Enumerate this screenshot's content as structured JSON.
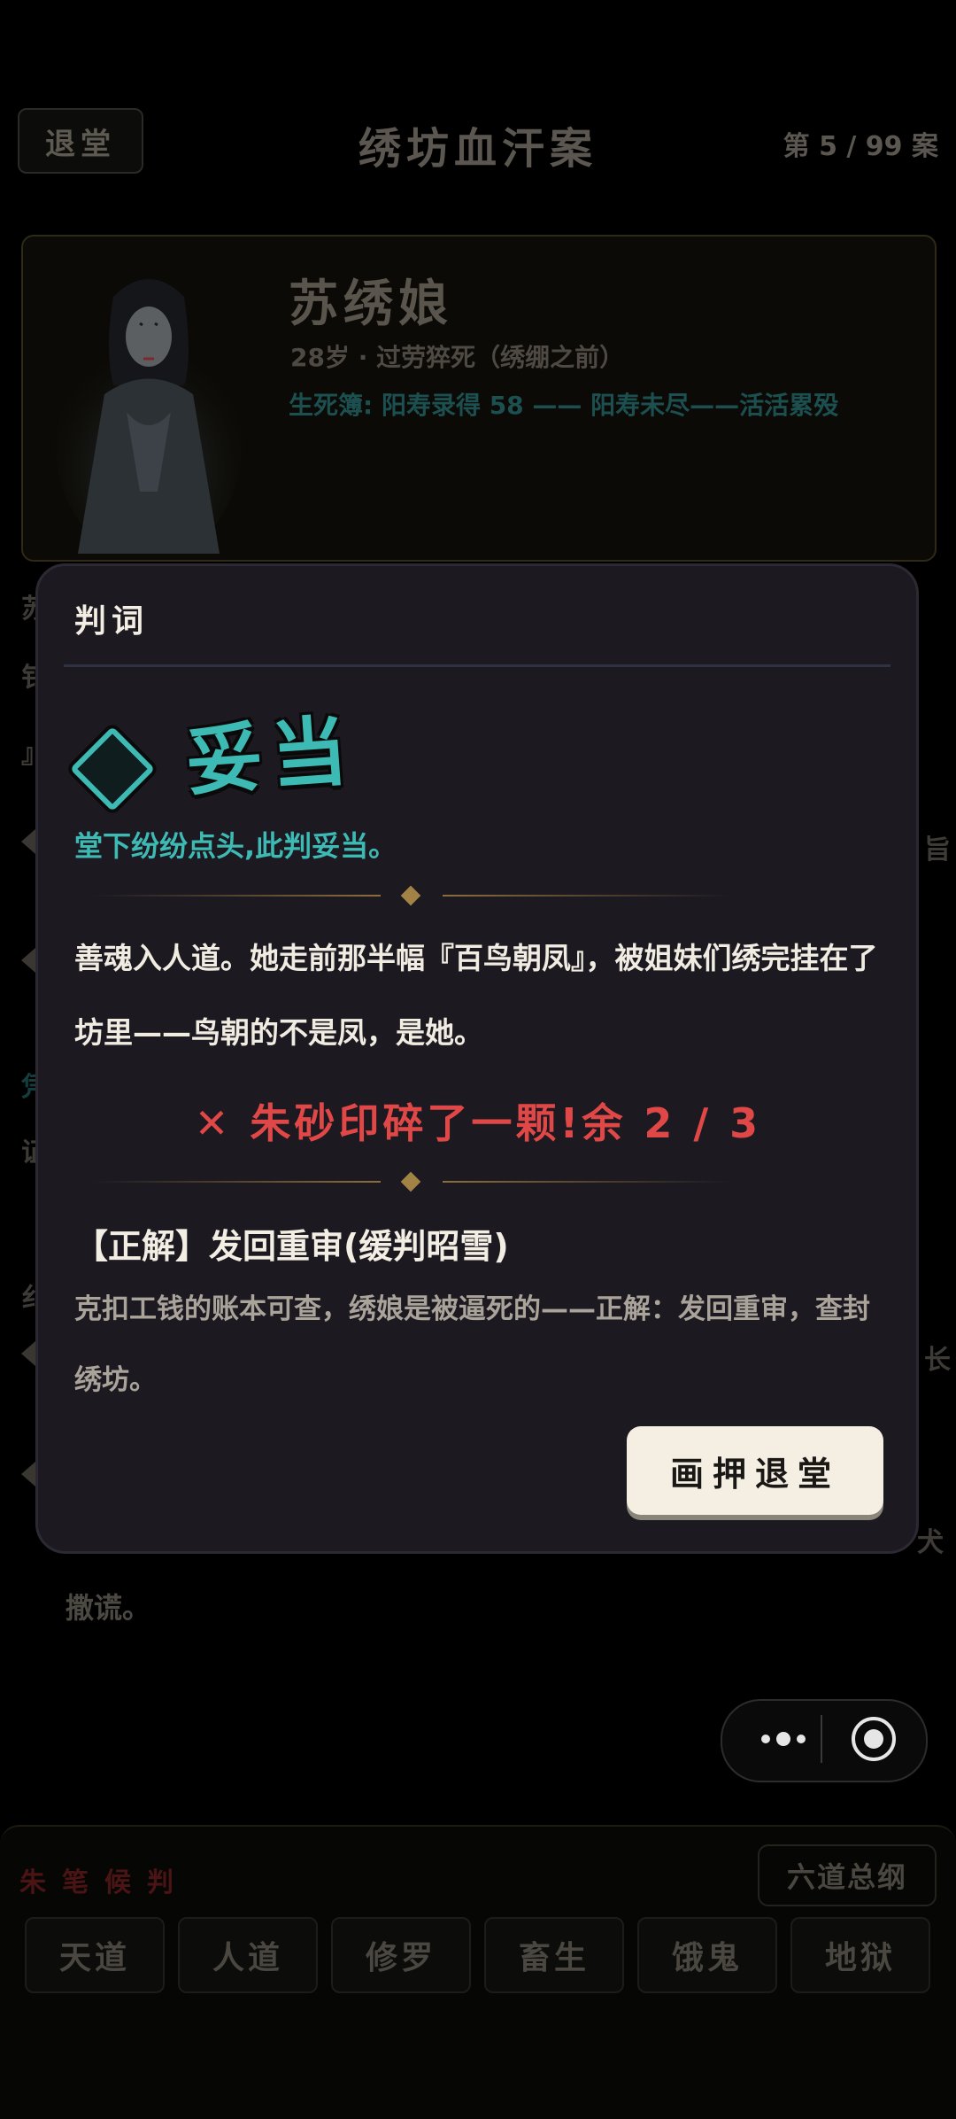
{
  "header": {
    "back_label": "退堂",
    "title": "绣坊血汗案",
    "progress": "第 5 / 99 案"
  },
  "profile": {
    "name": "苏绣娘",
    "meta": "28岁 · 过劳猝死（绣绷之前）",
    "lifebook": "生死簿: 阳寿录得 58 —— 阳寿未尽——活活累殁"
  },
  "background_partial": {
    "left_fragments": [
      "苏",
      "钅",
      "』",
      "凭",
      "证",
      "纟"
    ],
    "right_fragments": [
      "旨",
      "长",
      "犬"
    ],
    "lie_text": "撒谎。"
  },
  "modal": {
    "title": "判词",
    "verdict": "妥当",
    "verdict_sub": "堂下纷纷点头,此判妥当。",
    "story": "善魂入人道。她走前那半幅『百鸟朝凤』，被姐妹们绣完挂在了坊里——鸟朝的不是凤，是她。",
    "penalty": "✕ 朱砂印碎了一颗!余 2 / 3",
    "answer_head": "【正解】发回重审(缓判昭雪)",
    "answer_body": "克扣工钱的账本可查，绣娘是被逼死的——正解：发回重审，查封绣坊。",
    "sign_button": "画押退堂"
  },
  "bottom": {
    "section_label": "朱笔候判",
    "overview_button": "六道总纲",
    "paths": [
      "天道",
      "人道",
      "修罗",
      "畜生",
      "饿鬼",
      "地狱"
    ]
  },
  "colors": {
    "teal": "#3ebab4",
    "red": "#e04848",
    "modal_bg": "#1c1921",
    "cream": "#f4efe2"
  }
}
